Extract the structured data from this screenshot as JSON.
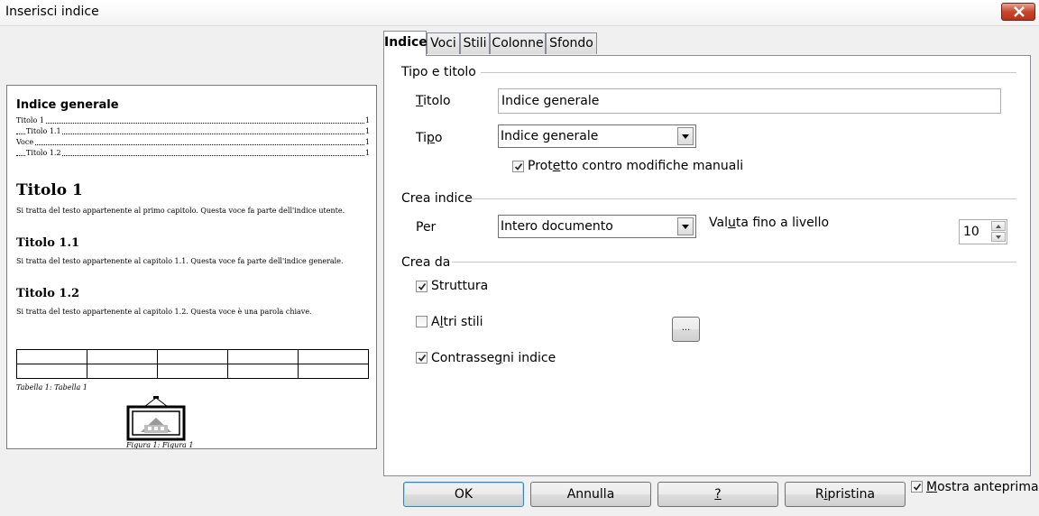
{
  "window": {
    "title": "Inserisci indice"
  },
  "preview": {
    "heading": "Indice generale",
    "toc": [
      {
        "text": "Titolo 1",
        "page": "1"
      },
      {
        "text": "Titolo 1.1",
        "page": "1"
      },
      {
        "text": "Voce",
        "page": "1"
      },
      {
        "text": "Titolo 1.2",
        "page": "1"
      }
    ],
    "sections": [
      {
        "title": "Titolo 1",
        "body": "Si tratta del testo appartenente al primo capitolo. Questa voce fa parte dell'indice utente."
      },
      {
        "title": "Titolo 1.1",
        "body": "Si tratta del testo appartenente al capitolo 1.1. Questa voce fa parte dell'indice generale."
      },
      {
        "title": "Titolo 1.2",
        "body": "Si tratta del testo appartenente al capitolo 1.2. Questa voce è una parola chiave."
      }
    ],
    "table_caption": "Tabella 1: Tabella 1",
    "figure_caption": "Figura 1: Figura 1"
  },
  "tabs": [
    "Indice",
    "Voci",
    "Stili",
    "Colonne",
    "Sfondo"
  ],
  "active_tab": "Indice",
  "tipo_titolo": {
    "section_label": "Tipo e titolo",
    "titolo_label": "Titolo",
    "titolo_value": "Indice generale",
    "tipo_label": "Tipo",
    "tipo_value": "Indice generale",
    "protetto_label": "Protetto contro modifiche manuali",
    "protetto_checked": true
  },
  "crea_indice": {
    "section_label": "Crea indice",
    "per_label": "Per",
    "per_value": "Intero documento",
    "valuta_label": "Valuta fino a livello",
    "livello_value": "10"
  },
  "crea_da": {
    "section_label": "Crea da",
    "struttura_label": "Struttura",
    "struttura_checked": true,
    "altri_stili_label": "Altri stili",
    "altri_stili_checked": false,
    "browse_label": "...",
    "contrassegni_label": "Contrassegni indice",
    "contrassegni_checked": true
  },
  "buttons": {
    "ok": "OK",
    "annulla": "Annulla",
    "help": "?",
    "ripristina": "Ripristina"
  },
  "mostra_anteprima": {
    "label": "Mostra anteprima",
    "checked": true
  }
}
